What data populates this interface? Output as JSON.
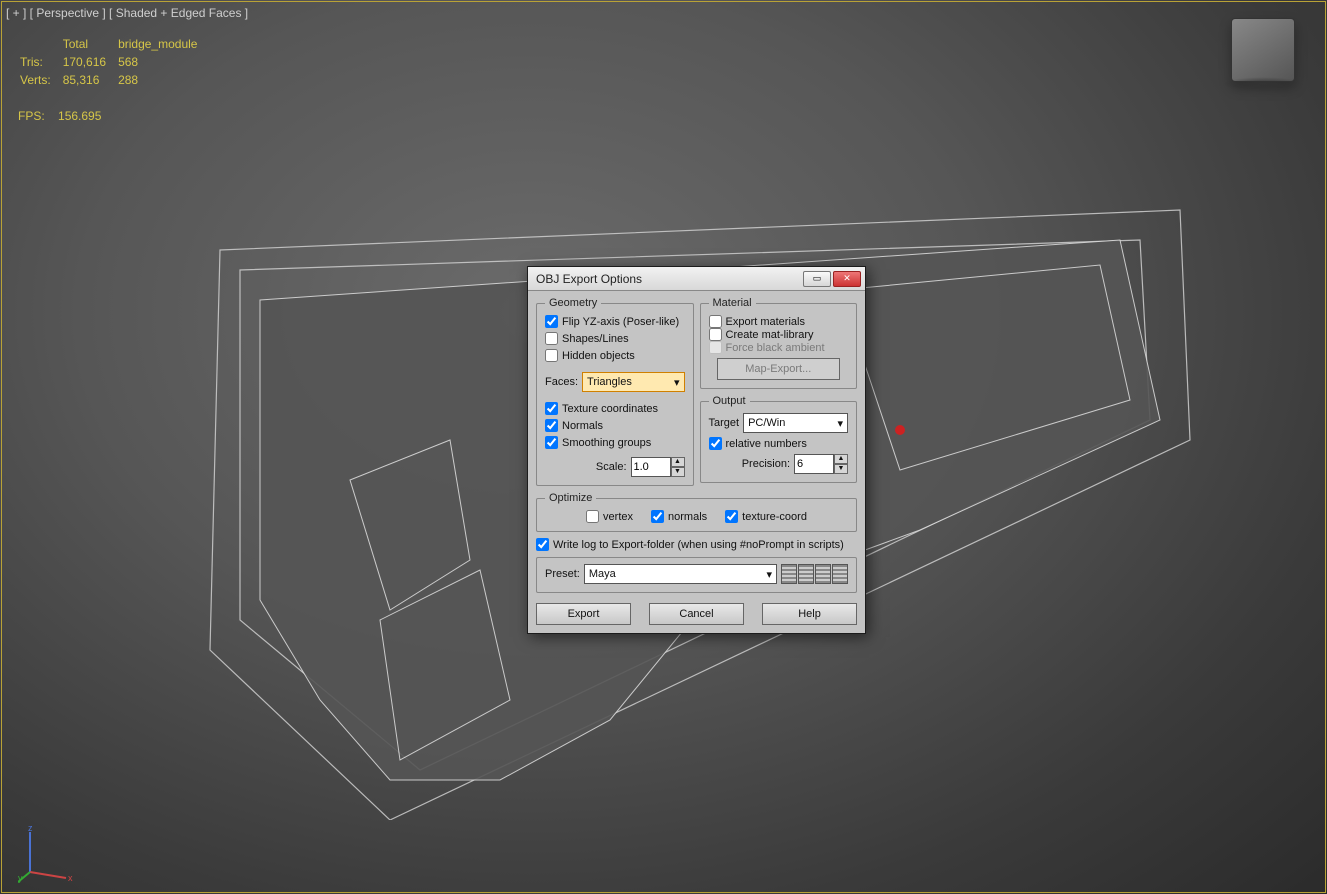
{
  "viewport": {
    "label": "[ + ] [ Perspective ] [ Shaded + Edged Faces ]"
  },
  "stats": {
    "headers": {
      "total": "Total",
      "object": "bridge_module"
    },
    "rows": {
      "tris_label": "Tris:",
      "tris_total": "170,616",
      "tris_obj": "568",
      "verts_label": "Verts:",
      "verts_total": "85,316",
      "verts_obj": "288"
    },
    "fps_label": "FPS:",
    "fps_value": "156.695"
  },
  "dialog": {
    "title": "OBJ Export Options",
    "geometry": {
      "legend": "Geometry",
      "flip_yz": "Flip YZ-axis (Poser-like)",
      "shapes": "Shapes/Lines",
      "hidden": "Hidden objects",
      "faces_label": "Faces:",
      "faces_value": "Triangles",
      "texcoord": "Texture coordinates",
      "normals": "Normals",
      "smoothing": "Smoothing groups",
      "scale_label": "Scale:",
      "scale_value": "1.0"
    },
    "material": {
      "legend": "Material",
      "export_mat": "Export materials",
      "create_lib": "Create mat-library",
      "force_black": "Force black ambient",
      "map_export": "Map-Export..."
    },
    "output": {
      "legend": "Output",
      "target_label": "Target",
      "target_value": "PC/Win",
      "relative": "relative numbers",
      "precision_label": "Precision:",
      "precision_value": "6"
    },
    "optimize": {
      "legend": "Optimize",
      "vertex": "vertex",
      "normals": "normals",
      "texcoord": "texture-coord"
    },
    "writelog": "Write log to Export-folder (when using #noPrompt in scripts)",
    "preset_label": "Preset:",
    "preset_value": "Maya",
    "buttons": {
      "export": "Export",
      "cancel": "Cancel",
      "help": "Help"
    }
  }
}
